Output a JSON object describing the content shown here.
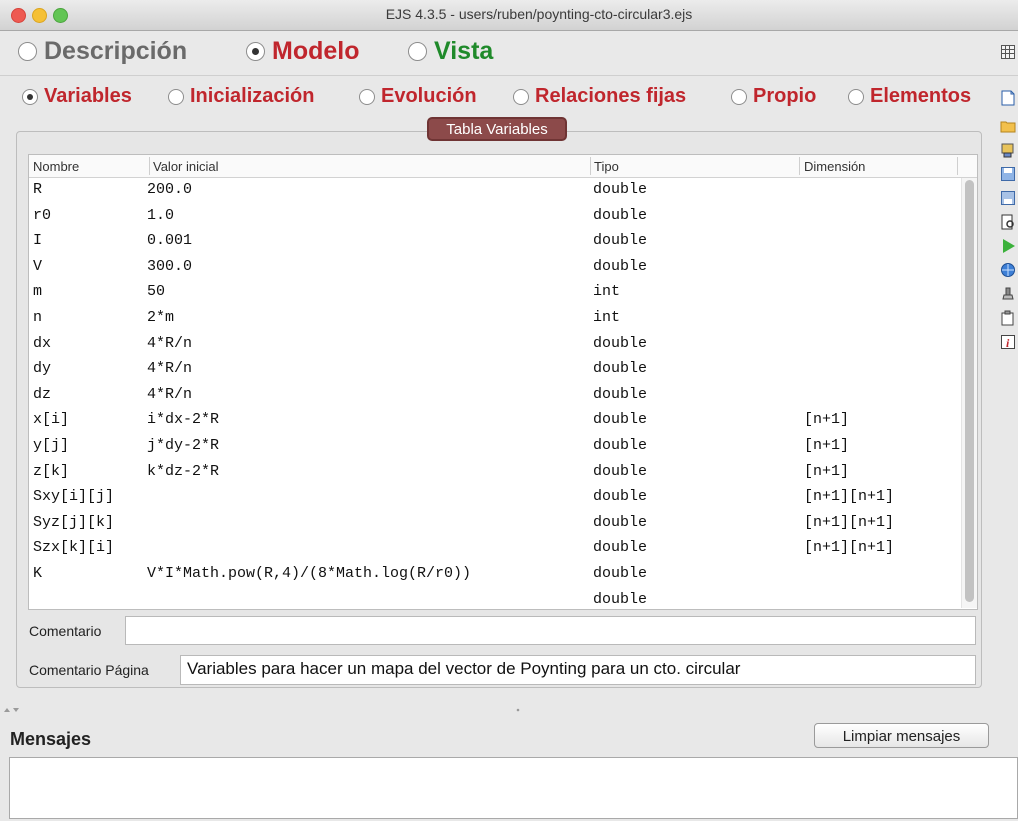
{
  "window": {
    "title": "EJS 4.3.5 - users/ruben/poynting-cto-circular3.ejs"
  },
  "modes": [
    {
      "label": "Descripción",
      "selected": false,
      "color": "#666666"
    },
    {
      "label": "Modelo",
      "selected": true,
      "color": "#c0262d"
    },
    {
      "label": "Vista",
      "selected": false,
      "color": "#1f8a2a"
    }
  ],
  "model_tabs": [
    {
      "label": "Variables",
      "selected": true
    },
    {
      "label": "Inicialización",
      "selected": false
    },
    {
      "label": "Evolución",
      "selected": false
    },
    {
      "label": "Relaciones fijas",
      "selected": false
    },
    {
      "label": "Propio",
      "selected": false
    },
    {
      "label": "Elementos",
      "selected": false
    }
  ],
  "page": {
    "tab_label": "Tabla Variables"
  },
  "table": {
    "columns": [
      "Nombre",
      "Valor inicial",
      "Tipo",
      "Dimensión"
    ],
    "rows": [
      {
        "name": "R",
        "value": "200.0",
        "type": "double",
        "dim": ""
      },
      {
        "name": "r0",
        "value": "1.0",
        "type": "double",
        "dim": ""
      },
      {
        "name": "I",
        "value": "0.001",
        "type": "double",
        "dim": ""
      },
      {
        "name": "V",
        "value": "300.0",
        "type": "double",
        "dim": ""
      },
      {
        "name": "m",
        "value": "50",
        "type": "int",
        "dim": ""
      },
      {
        "name": "n",
        "value": "2*m",
        "type": "int",
        "dim": ""
      },
      {
        "name": "dx",
        "value": "4*R/n",
        "type": "double",
        "dim": ""
      },
      {
        "name": "dy",
        "value": "4*R/n",
        "type": "double",
        "dim": ""
      },
      {
        "name": "dz",
        "value": "4*R/n",
        "type": "double",
        "dim": ""
      },
      {
        "name": "x[i]",
        "value": "i*dx-2*R",
        "type": "double",
        "dim": "[n+1]"
      },
      {
        "name": "y[j]",
        "value": "j*dy-2*R",
        "type": "double",
        "dim": "[n+1]"
      },
      {
        "name": "z[k]",
        "value": "k*dz-2*R",
        "type": "double",
        "dim": "[n+1]"
      },
      {
        "name": "Sxy[i][j]",
        "value": "",
        "type": "double",
        "dim": "[n+1][n+1]"
      },
      {
        "name": "Syz[j][k]",
        "value": "",
        "type": "double",
        "dim": "[n+1][n+1]"
      },
      {
        "name": "Szx[k][i]",
        "value": "",
        "type": "double",
        "dim": "[n+1][n+1]"
      },
      {
        "name": "K",
        "value": "V*I*Math.pow(R,4)/(8*Math.log(R/r0))",
        "type": "double",
        "dim": ""
      },
      {
        "name": "",
        "value": "",
        "type": "double",
        "dim": ""
      }
    ]
  },
  "comment": {
    "label": "Comentario",
    "value": ""
  },
  "page_comment": {
    "label": "Comentario Página",
    "value": "Variables para hacer un mapa del vector de Poynting para un cto. circular"
  },
  "messages": {
    "label": "Mensajes",
    "clear_button": "Limpiar mensajes"
  },
  "icons": [
    "grid-icon",
    "new-doc-icon",
    "open-folder-icon",
    "library-icon",
    "save-icon",
    "save-as-icon",
    "search-doc-icon",
    "run-icon",
    "web-icon",
    "stamp-icon",
    "clipboard-icon",
    "info-icon"
  ]
}
